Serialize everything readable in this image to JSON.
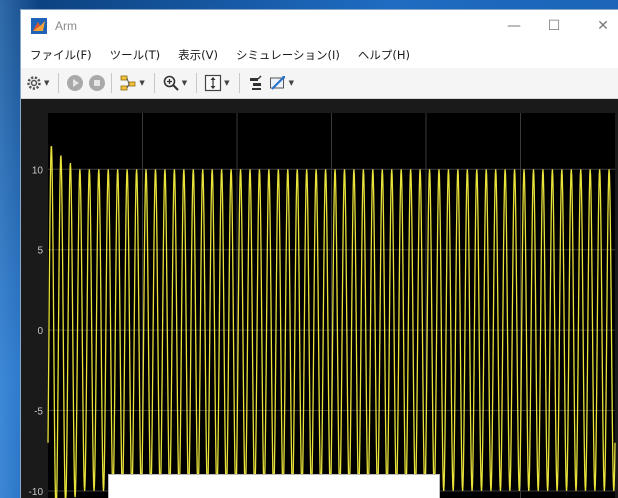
{
  "window": {
    "title": "Arm",
    "minimize_glyph": "—",
    "maximize_glyph": "☐",
    "close_glyph": "✕"
  },
  "menu": [
    {
      "label": "ファイル(F)"
    },
    {
      "label": "ツール(T)"
    },
    {
      "label": "表示(V)"
    },
    {
      "label": "シミュレーション(I)"
    },
    {
      "label": "ヘルプ(H)"
    }
  ],
  "toolbar": {
    "icons": [
      "gear-icon",
      "run-icon",
      "stop-icon",
      "highlight-icon",
      "zoom-icon",
      "scale-axes-icon",
      "style-icon",
      "measure-icon"
    ]
  },
  "colors": {
    "signal": "#e8e23a",
    "background": "#000000",
    "grid": "#3a3a3a",
    "axis_text": "#c8c8c8"
  },
  "chart_data": {
    "type": "line",
    "ylim": [
      -10.5,
      13.5
    ],
    "yticks": [
      {
        "value": 10,
        "label": "10"
      },
      {
        "value": 5,
        "label": "5"
      },
      {
        "value": 0,
        "label": "0"
      },
      {
        "value": -5,
        "label": "-5"
      },
      {
        "value": -10,
        "label": "-10"
      }
    ],
    "series": [
      {
        "amplitude": 10,
        "cycles": 60,
        "overshoot_peaks": [
          11.5,
          10.9,
          10.4
        ],
        "start_value": -7
      }
    ]
  }
}
